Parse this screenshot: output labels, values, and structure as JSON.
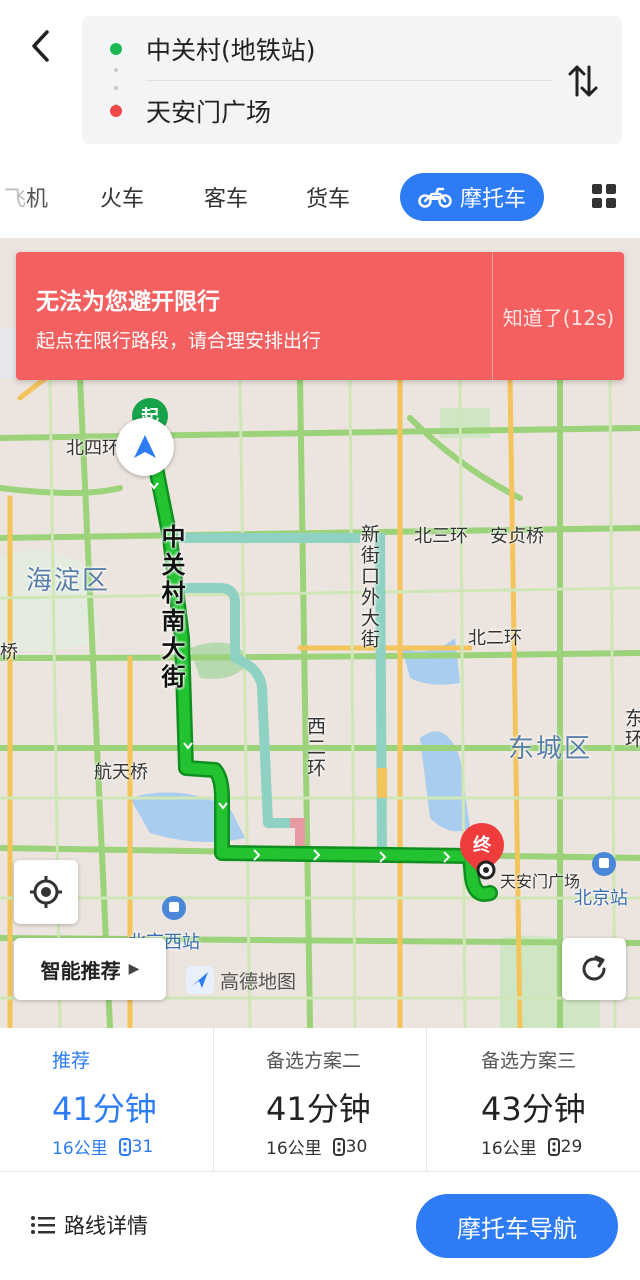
{
  "route": {
    "start": "中关村(地铁站)",
    "end": "天安门广场"
  },
  "tabs": {
    "items": [
      "机",
      "火车",
      "客车",
      "货车",
      "摩托车"
    ],
    "active": "摩托车"
  },
  "alert": {
    "title": "无法为您避开限行",
    "subtitle": "起点在限行路段，请合理安排出行",
    "dismiss": "知道了(12s)"
  },
  "map": {
    "labels": {
      "haidian": "海淀区",
      "dongcheng": "东城区",
      "beisihuan": "北四环",
      "beisanhuan": "北三环",
      "anzhenqiao": "安贞桥",
      "beierhuan": "北二环",
      "hangtianqiao": "航天桥",
      "xierhuan": "西二环",
      "xinjiekou": "新街口外大街",
      "road": "中关村南大街",
      "qiao": "桥",
      "dong_edge": "东环",
      "tiananmen": "天安门广场",
      "beijingzhan": "北京站",
      "beijingxizhan": "北京西站"
    },
    "start_marker": "起",
    "end_marker": "终",
    "smart_recommend": "智能推荐",
    "logo": "高德地图",
    "route_color": "#19b22c",
    "alt_route_color": "#8fd1c3"
  },
  "plans": [
    {
      "label": "推荐",
      "time": "41分钟",
      "distance": "16公里",
      "lights": "31",
      "selected": true
    },
    {
      "label": "备选方案二",
      "time": "41分钟",
      "distance": "16公里",
      "lights": "30",
      "selected": false
    },
    {
      "label": "备选方案三",
      "time": "43分钟",
      "distance": "16公里",
      "lights": "29",
      "selected": false
    }
  ],
  "footer": {
    "details": "路线详情",
    "navigate": "摩托车导航"
  },
  "colors": {
    "accent": "#2d7cf6",
    "alert": "#f45f5f",
    "start": "#1db954",
    "end": "#f04848"
  }
}
